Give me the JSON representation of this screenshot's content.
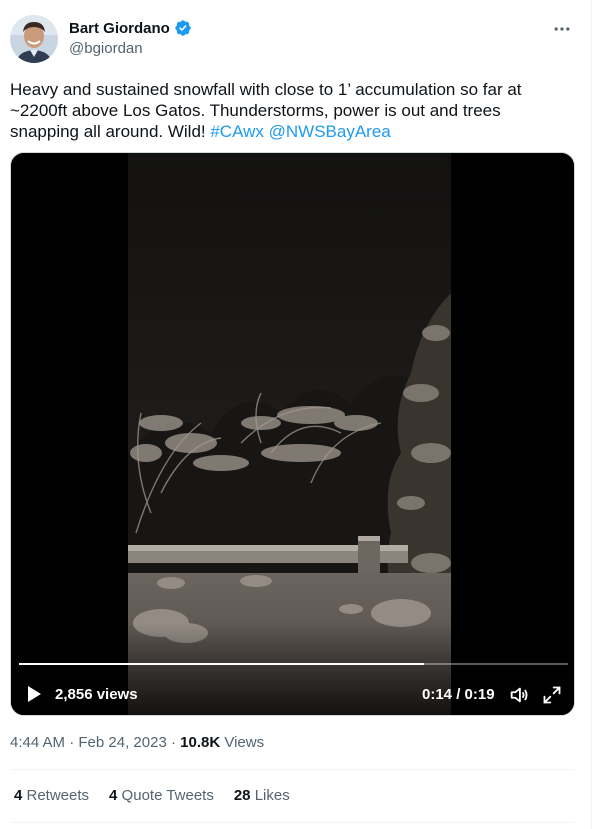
{
  "author": {
    "display_name": "Bart Giordano",
    "handle": "@bgiordan"
  },
  "tweet": {
    "text_main": "Heavy and sustained snowfall with close to 1’ accumulation so far at ~2200ft above Los Gatos. Thunderstorms, power is out and trees snapping all around. Wild! ",
    "hashtag": "#CAwx",
    "mention": "@NWSBayArea"
  },
  "video": {
    "views": "2,856 views",
    "current_time": "0:14",
    "separator": " / ",
    "duration": "0:19",
    "progress_fraction": 0.737
  },
  "meta": {
    "time": "4:44 AM",
    "dot1": " · ",
    "date": "Feb 24, 2023",
    "dot2": " · ",
    "view_count": "10.8K",
    "views_label": " Views"
  },
  "stats": {
    "retweets_count": "4",
    "retweets_label": " Retweets",
    "quotes_count": "4",
    "quotes_label": " Quote Tweets",
    "likes_count": "28",
    "likes_label": " Likes"
  },
  "colors": {
    "link": "#1d9bf0",
    "secondary_text": "#536471",
    "verified": "#1d9bf0"
  },
  "icons": [
    "verified-badge-icon",
    "more-icon",
    "play-icon",
    "volume-icon",
    "fullscreen-icon"
  ]
}
